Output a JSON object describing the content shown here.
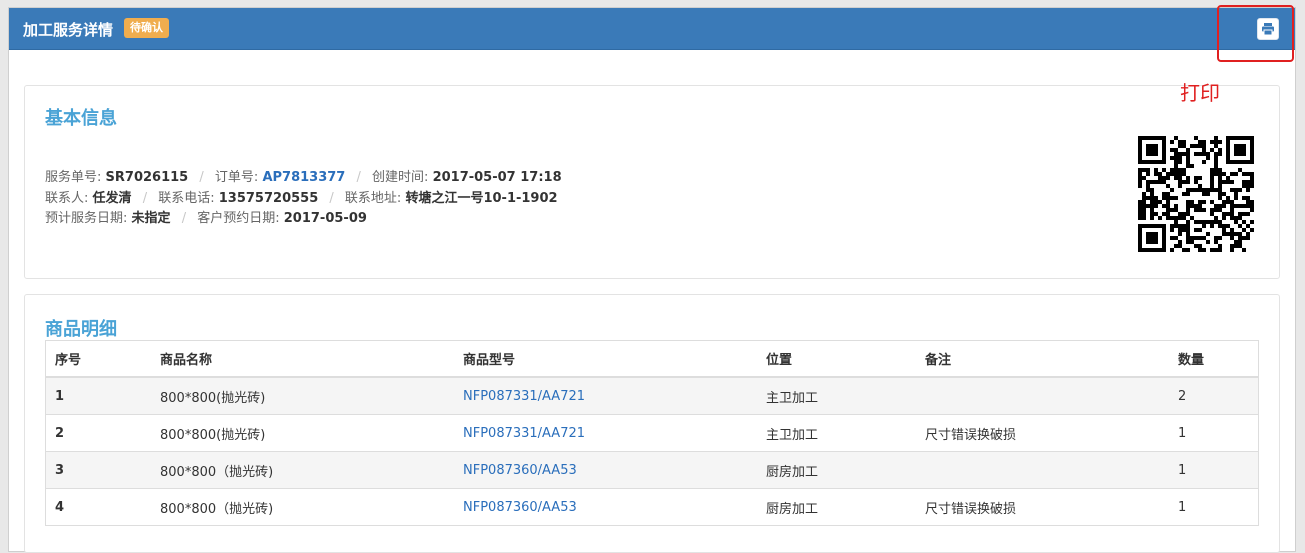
{
  "header": {
    "title": "加工服务详情",
    "status": "待确认",
    "print_icon": "printer-icon"
  },
  "annotation": {
    "label": "打印",
    "color": "#e02020"
  },
  "basic_info": {
    "title": "基本信息",
    "service_no_label": "服务单号:",
    "service_no": "SR7026115",
    "order_no_label": "订单号:",
    "order_no": "AP7813377",
    "created_label": "创建时间:",
    "created": "2017-05-07 17:18",
    "contact_label": "联系人:",
    "contact": "任发清",
    "phone_label": "联系电话:",
    "phone": "13575720555",
    "address_label": "联系地址:",
    "address": "转塘之江一号10-1-1902",
    "planned_date_label": "预计服务日期:",
    "planned_date": "未指定",
    "appointment_label": "客户预约日期:",
    "appointment": "2017-05-09",
    "separator": "/"
  },
  "items": {
    "title": "商品明细",
    "columns": [
      "序号",
      "商品名称",
      "商品型号",
      "位置",
      "备注",
      "数量"
    ],
    "rows": [
      {
        "idx": "1",
        "name": "800*800(抛光砖)",
        "model": "NFP087331/AA721",
        "location": "主卫加工",
        "note": "",
        "qty": "2"
      },
      {
        "idx": "2",
        "name": "800*800(抛光砖)",
        "model": "NFP087331/AA721",
        "location": "主卫加工",
        "note": "尺寸错误换破损",
        "qty": "1"
      },
      {
        "idx": "3",
        "name": "800*800（抛光砖)",
        "model": "NFP087360/AA53",
        "location": "厨房加工",
        "note": "",
        "qty": "1"
      },
      {
        "idx": "4",
        "name": "800*800（抛光砖)",
        "model": "NFP087360/AA53",
        "location": "厨房加工",
        "note": "尺寸错误换破损",
        "qty": "1"
      }
    ]
  },
  "colors": {
    "header_bg": "#3a7ab8",
    "status_badge": "#f0ad4e",
    "section_title": "#4aa3d6",
    "link": "#2a6ebb"
  }
}
